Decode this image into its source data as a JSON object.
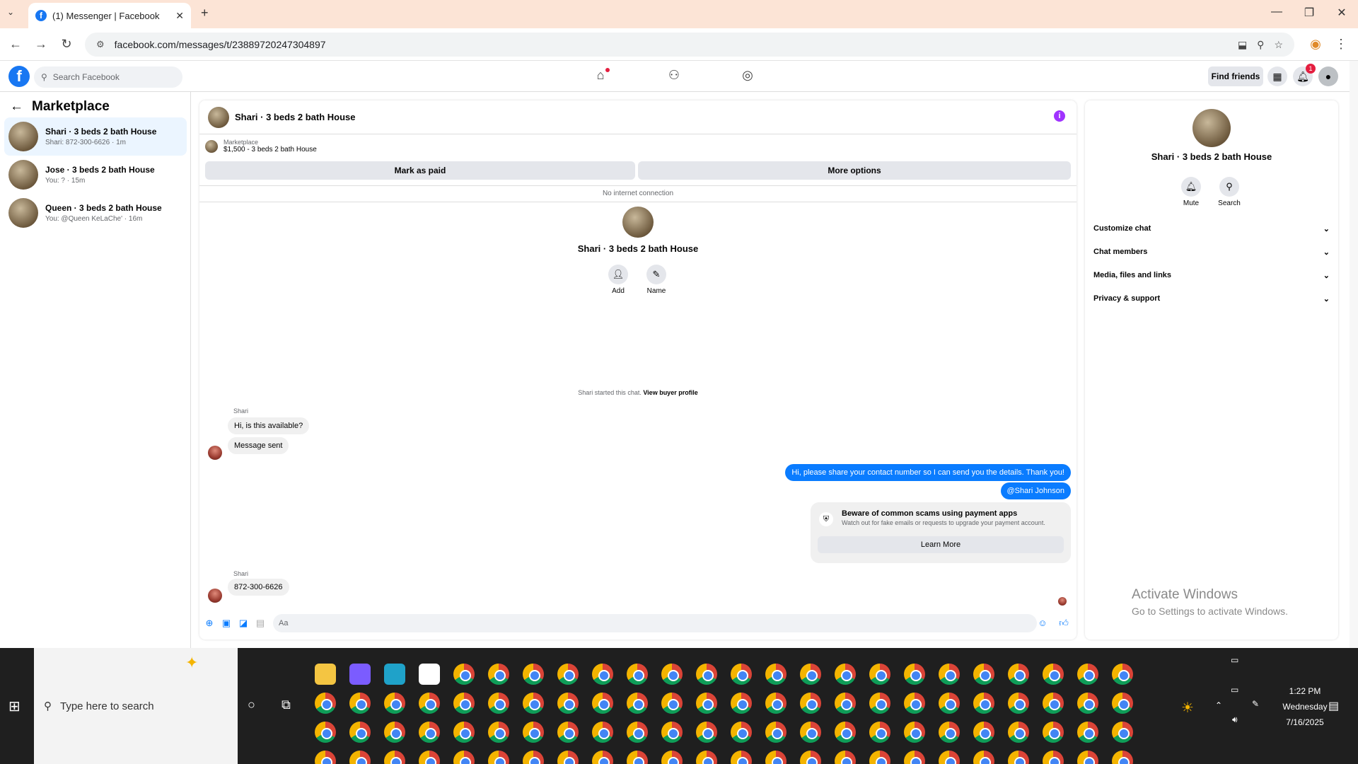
{
  "browser": {
    "tab_title": "(1) Messenger | Facebook",
    "url": "facebook.com/messages/t/23889720247304897",
    "new_tab_icon": "plus-icon"
  },
  "facebook": {
    "search_placeholder": "Search Facebook",
    "find_friends": "Find friends",
    "notification_count": "1"
  },
  "left": {
    "title": "Marketplace",
    "conversations": [
      {
        "name": "Shari · 3 beds 2 bath House",
        "preview": "Shari: 872-300-6626 · 1m"
      },
      {
        "name": "Jose · 3 beds 2 bath House",
        "preview": "You: ? · 15m"
      },
      {
        "name": "Queen · 3 beds 2 bath House",
        "preview": "You: @Queen KeLaChe' · 16m"
      }
    ]
  },
  "chat": {
    "header_name": "Shari · 3 beds 2 bath House",
    "listing_label": "Marketplace",
    "listing_detail": "$1,500 - 3 beds 2 bath House",
    "mark_as_paid": "Mark as paid",
    "more_options": "More options",
    "no_connection": "No internet connection",
    "center_name": "Shari · 3 beds 2 bath House",
    "add_label": "Add",
    "name_label": "Name",
    "started_text": "Shari started this chat.",
    "view_buyer": "View buyer profile",
    "sender1": "Shari",
    "msg1": "Hi, is this available?",
    "msg2": "Message sent",
    "out1": "Hi, please share your contact number so I can send you the details. Thank you!",
    "out2": "@Shari Johnson",
    "warn_title": "Beware of common scams using payment apps",
    "warn_sub": "Watch out for fake emails or requests to upgrade your payment account.",
    "learn_more": "Learn More",
    "sender2": "Shari",
    "msg3": "872-300-6626",
    "composer_placeholder": "Aa"
  },
  "right": {
    "name": "Shari · 3 beds 2 bath House",
    "mute": "Mute",
    "search": "Search",
    "rows": [
      "Customize chat",
      "Chat members",
      "Media, files and links",
      "Privacy & support"
    ]
  },
  "watermark": {
    "line1": "Activate Windows",
    "line2": "Go to Settings to activate Windows."
  },
  "taskbar": {
    "search_placeholder": "Type here to search",
    "time": "1:22 PM",
    "day": "Wednesday",
    "date": "7/16/2025"
  }
}
